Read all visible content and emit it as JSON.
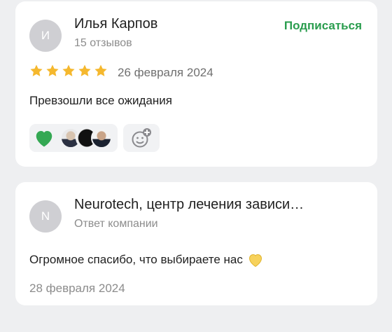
{
  "review": {
    "avatar_letter": "И",
    "author": "Илья Карпов",
    "reviews_count": "15 отзывов",
    "subscribe_label": "Подписаться",
    "rating": 5,
    "date": "26 февраля 2024",
    "text": "Превзошли все ожидания",
    "colors": {
      "star": "#f5b82e",
      "subscribe": "#2a9d4e",
      "heart": "#34a853"
    }
  },
  "reply": {
    "avatar_letter": "N",
    "company": "Neurotech, центр лечения зависи…",
    "label": "Ответ компании",
    "text": "Огромное спасибо, что выбираете нас",
    "emoji": "yellow-heart-icon",
    "date": "28 февраля 2024"
  }
}
